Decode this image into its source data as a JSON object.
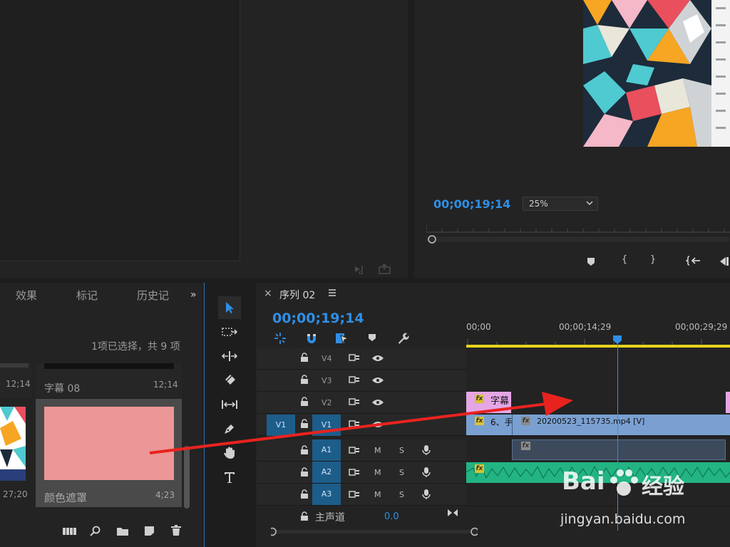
{
  "program": {
    "timecode": "00;00;19;14",
    "zoom": "25%",
    "transport_icons": [
      "marker-icon",
      "mark-in-icon",
      "mark-out-icon",
      "go-to-in-icon",
      "step-back-icon"
    ]
  },
  "project": {
    "tabs": [
      "效果",
      "标记",
      "历史记"
    ],
    "status": "1项已选择，共 9 项",
    "items": [
      {
        "name": "",
        "duration": "12;14"
      },
      {
        "name": "字幕 08",
        "duration": "12;14"
      },
      {
        "name": "",
        "duration": "27;20"
      },
      {
        "name": "颜色遮罩",
        "duration": "4;23"
      }
    ],
    "mask_color": "#ec9797",
    "footer_icons": [
      "freeform-view-icon",
      "find-icon",
      "new-bin-icon",
      "new-item-icon",
      "trash-icon"
    ]
  },
  "tools": [
    "selection-tool-icon",
    "track-select-tool-icon",
    "ripple-edit-tool-icon",
    "razor-tool-icon",
    "slip-tool-icon",
    "pen-tool-icon",
    "hand-tool-icon",
    "type-tool-icon"
  ],
  "timeline": {
    "close": "×",
    "sequence_name": "序列 02",
    "timecode": "00;00;19;14",
    "ruler": [
      "00;00",
      "00;00;14;29",
      "00;00;29;29"
    ],
    "tracks": {
      "video": [
        {
          "name": "V4"
        },
        {
          "name": "V3"
        },
        {
          "name": "V2"
        },
        {
          "name": "V1",
          "source": "V1"
        }
      ],
      "audio": [
        {
          "name": "A1",
          "m": "M",
          "s": "S"
        },
        {
          "name": "A2",
          "m": "M",
          "s": "S"
        },
        {
          "name": "A3",
          "m": "M",
          "s": "S"
        }
      ]
    },
    "master": {
      "label": "主声道",
      "value": "0.0"
    },
    "clips": {
      "v2_title": "字幕",
      "v1_a": "6、手",
      "v1_b": "20200523_115735.mp4 [V]",
      "fx": "fx"
    },
    "colors": {
      "accent": "#2f8fe6",
      "video_clip": "#7aa0d2",
      "title_clip": "#e5a6e5",
      "audio_clip": "#23b483",
      "workarea": "#e5d21c"
    }
  },
  "watermark": {
    "brand": "Bai",
    "brand2": "经验",
    "url": "jingyan.baidu.com"
  }
}
